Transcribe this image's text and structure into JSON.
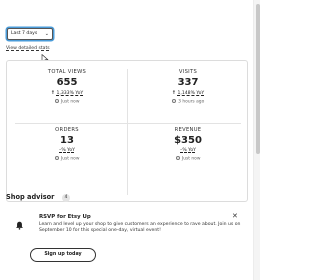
{
  "filters": {
    "range_value": "Last 7 days"
  },
  "stats_link": "View detailed stats",
  "stats": [
    {
      "label": "TOTAL VIEWS",
      "value": "655",
      "change": "1,333% YoY",
      "arrow": "up",
      "updated": "Just now"
    },
    {
      "label": "VISITS",
      "value": "337",
      "change": "1,148% YoY",
      "arrow": "up",
      "updated": "3 hours ago"
    },
    {
      "label": "ORDERS",
      "value": "13",
      "change": "–% YoY",
      "arrow": "none",
      "updated": "Just now"
    },
    {
      "label": "REVENUE",
      "value": "$350",
      "change": "–% YoY",
      "arrow": "none",
      "updated": "Just now"
    }
  ],
  "advisor": {
    "title": "Shop advisor",
    "count": "4",
    "promo": {
      "title": "RSVP for Etsy Up",
      "body": "Learn and level up your shop to give customers an experience to rave about. Join us on September 10 for this special one-day, virtual event!",
      "cta": "Sign up today"
    }
  },
  "icons": [
    "chevron-down-icon",
    "cursor-icon",
    "arrow-up-icon",
    "clock-icon",
    "bell-icon",
    "close-icon"
  ]
}
